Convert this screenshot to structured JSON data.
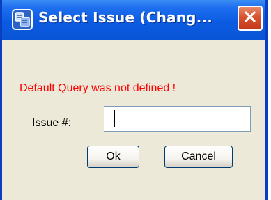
{
  "window": {
    "title": "Select Issue (Chang...",
    "icon": "app-icon",
    "close_icon": "close-icon"
  },
  "dialog": {
    "message": "Default Query was not defined !",
    "message_color": "#ff0000",
    "issue_label": "Issue #:",
    "issue_value": "",
    "ok_label": "Ok",
    "cancel_label": "Cancel"
  },
  "colors": {
    "titlebar": "#0a55d6",
    "client_bg": "#ece9d8",
    "close_button": "#d7532e"
  }
}
